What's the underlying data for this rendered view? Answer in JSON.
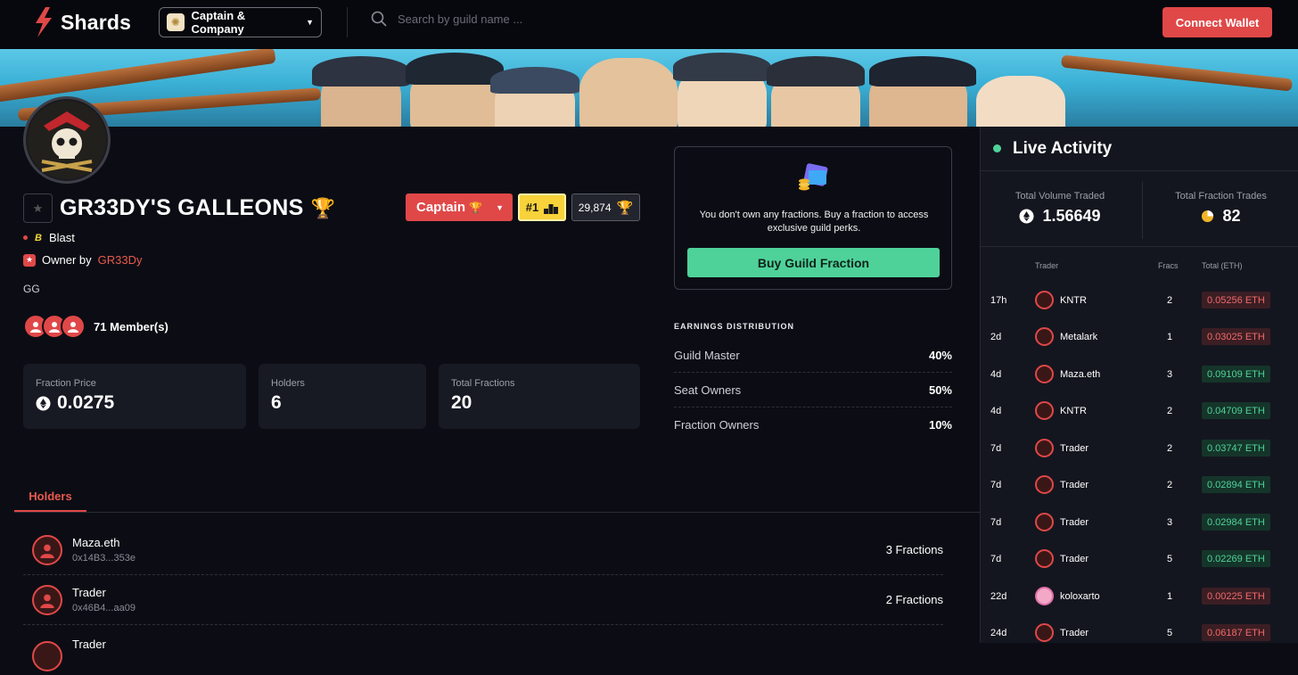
{
  "header": {
    "logo_text": "Shards",
    "company_name": "Captain & Company",
    "search_placeholder": "Search by guild name ...",
    "connect_label": "Connect Wallet"
  },
  "guild": {
    "name": "GR33DY'S GALLEONS",
    "chain": "Blast",
    "owner_prefix": "Owner by",
    "owner_name": "GR33Dy",
    "description": "GG",
    "members_text": "71 Member(s)",
    "role_label": "Captain",
    "rank_label": "#1",
    "score_label": "29,874"
  },
  "stats": [
    {
      "label": "Fraction Price",
      "value": "0.0275"
    },
    {
      "label": "Holders",
      "value": "6"
    },
    {
      "label": "Total Fractions",
      "value": "20"
    }
  ],
  "fraction_card": {
    "message": "You don't own any fractions. Buy a fraction to access exclusive guild perks.",
    "buy_label": "Buy Guild Fraction"
  },
  "earnings": {
    "title": "EARNINGS DISTRIBUTION",
    "rows": [
      {
        "label": "Guild Master",
        "pct": "40%"
      },
      {
        "label": "Seat Owners",
        "pct": "50%"
      },
      {
        "label": "Fraction Owners",
        "pct": "10%"
      }
    ]
  },
  "tabs": {
    "holders": "Holders"
  },
  "holders": [
    {
      "name": "Maza.eth",
      "address": "0x14B3...353e",
      "fractions": "3 Fractions"
    },
    {
      "name": "Trader",
      "address": "0x46B4...aa09",
      "fractions": "2 Fractions"
    },
    {
      "name": "Trader",
      "address": "",
      "fractions": ""
    }
  ],
  "live": {
    "title": "Live Activity",
    "volume_label": "Total Volume Traded",
    "volume_value": "1.56649",
    "trades_label": "Total Fraction Trades",
    "trades_value": "82",
    "col_trader": "Trader",
    "col_fracs": "Fracs",
    "col_total": "Total (ETH)",
    "rows": [
      {
        "time": "17h",
        "trader": "KNTR",
        "fracs": "2",
        "total": "0.05256 ETH",
        "status": "red"
      },
      {
        "time": "2d",
        "trader": "Metalark",
        "fracs": "1",
        "total": "0.03025 ETH",
        "status": "red"
      },
      {
        "time": "4d",
        "trader": "Maza.eth",
        "fracs": "3",
        "total": "0.09109 ETH",
        "status": "green"
      },
      {
        "time": "4d",
        "trader": "KNTR",
        "fracs": "2",
        "total": "0.04709 ETH",
        "status": "green"
      },
      {
        "time": "7d",
        "trader": "Trader",
        "fracs": "2",
        "total": "0.03747 ETH",
        "status": "green"
      },
      {
        "time": "7d",
        "trader": "Trader",
        "fracs": "2",
        "total": "0.02894 ETH",
        "status": "green"
      },
      {
        "time": "7d",
        "trader": "Trader",
        "fracs": "3",
        "total": "0.02984 ETH",
        "status": "green"
      },
      {
        "time": "7d",
        "trader": "Trader",
        "fracs": "5",
        "total": "0.02269 ETH",
        "status": "green"
      },
      {
        "time": "22d",
        "trader": "koloxarto",
        "fracs": "1",
        "total": "0.00225 ETH",
        "status": "red"
      },
      {
        "time": "24d",
        "trader": "Trader",
        "fracs": "5",
        "total": "0.06187 ETH",
        "status": "red"
      }
    ]
  },
  "colors": {
    "accent": "#e04848",
    "positive": "#4fd29a",
    "background": "#0c0d14"
  }
}
